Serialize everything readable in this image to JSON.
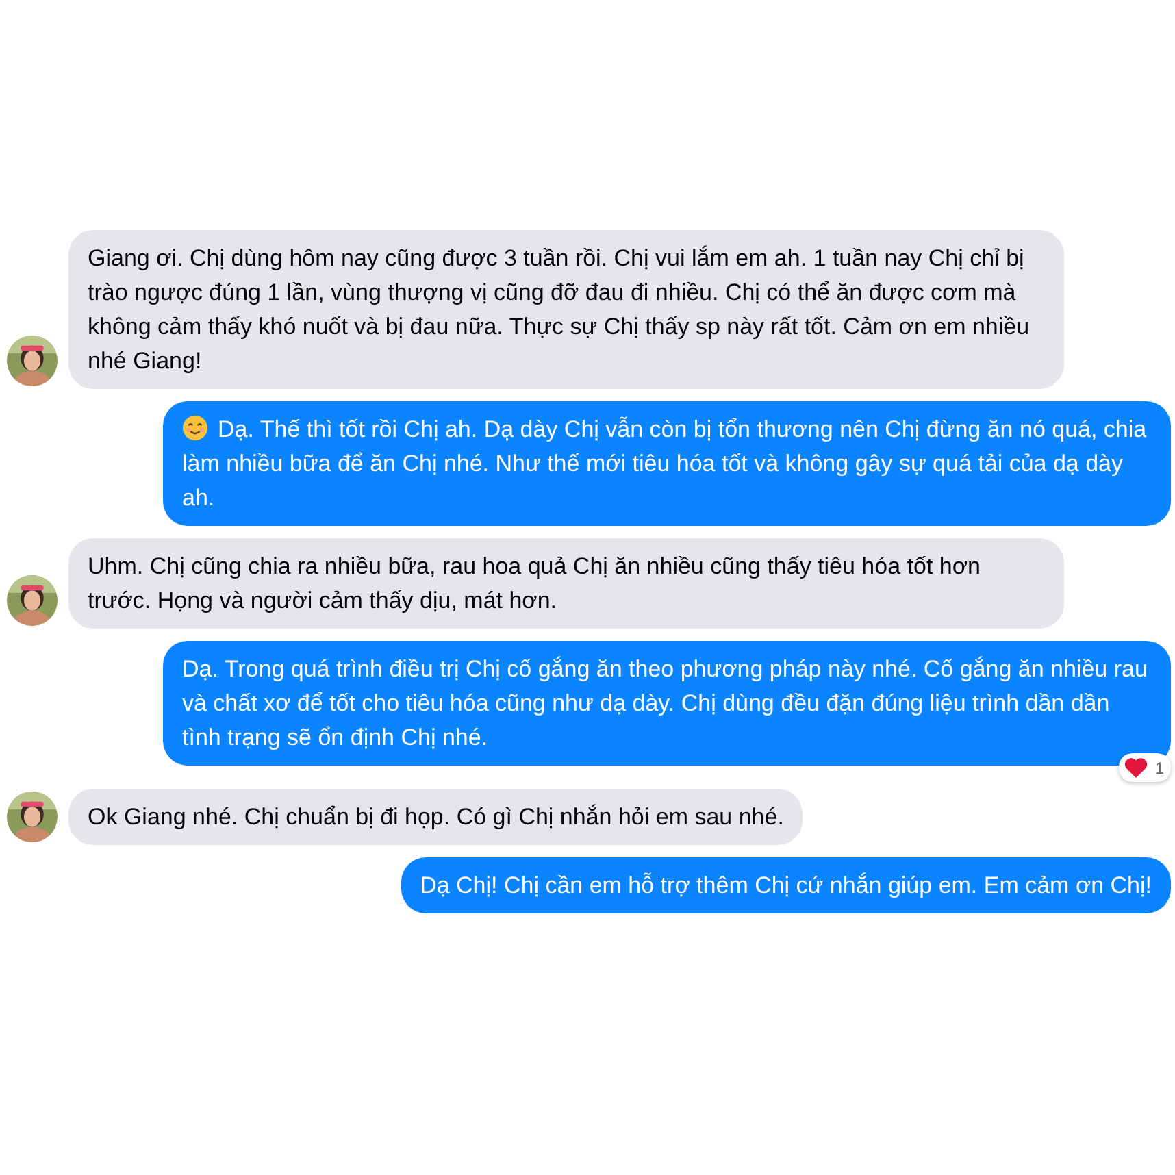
{
  "messages": [
    {
      "kind": "incoming",
      "text": "Giang ơi. Chị dùng hôm nay cũng được 3 tuần rồi. Chị vui lắm em ah. 1 tuần nay Chị chỉ bị trào ngược đúng 1 lần, vùng thượng vị cũng đỡ đau đi nhiều. Chị có thể ăn được cơm mà không cảm thấy khó nuốt và bị đau nữa. Thực sự Chị thấy sp này rất tốt. Cảm ơn em nhiều nhé Giang!"
    },
    {
      "kind": "outgoing",
      "emoji": true,
      "text": "Dạ. Thế thì tốt rồi Chị ah. Dạ dày Chị vẫn còn bị tổn thương nên Chị đừng ăn nó quá, chia làm nhiều bữa để ăn Chị nhé. Như thế mới tiêu hóa tốt và không gây sự quá tải của dạ dày ah."
    },
    {
      "kind": "incoming",
      "text": "Uhm. Chị cũng chia ra nhiều bữa, rau hoa quả Chị ăn nhiều cũng thấy tiêu hóa tốt hơn trước. Họng và người cảm thấy dịu, mát hơn."
    },
    {
      "kind": "outgoing",
      "text": "Dạ. Trong quá trình điều trị Chị cố gắng ăn theo phương pháp này nhé. Cố gắng ăn nhiều rau và chất xơ để tốt cho tiêu hóa cũng như dạ dày. Chị dùng đều đặn đúng liệu trình dần dần tình trạng sẽ ổn định Chị nhé.",
      "reaction": {
        "count": "1"
      }
    },
    {
      "kind": "incoming",
      "text": "Ok Giang nhé. Chị chuẩn bị đi họp. Có gì Chị nhắn hỏi em sau nhé."
    },
    {
      "kind": "outgoing",
      "text": "Dạ Chị! Chị cần em hỗ trợ thêm Chị cứ nhắn giúp em. Em cảm ơn Chị!"
    }
  ]
}
